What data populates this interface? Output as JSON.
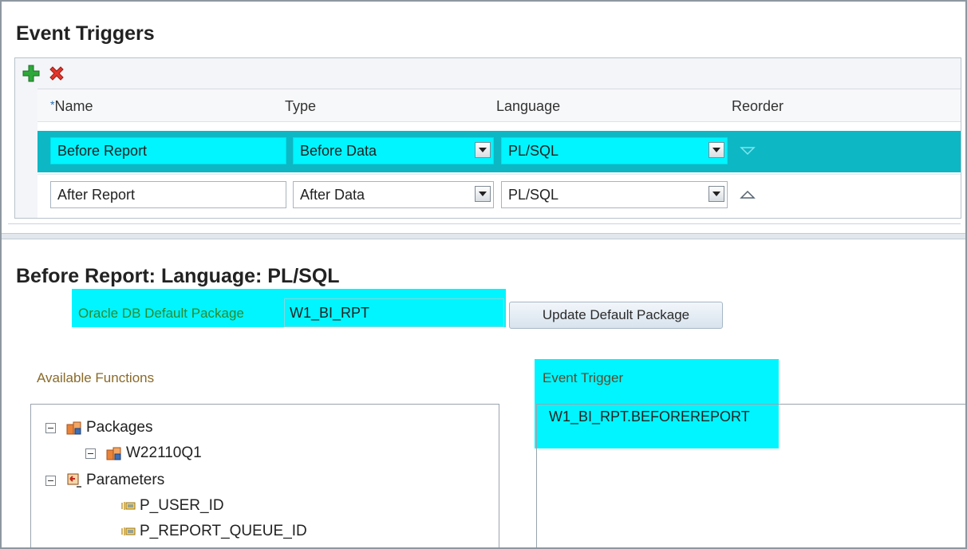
{
  "event_triggers": {
    "title": "Event Triggers",
    "toolbar": {
      "add_icon": "plus-icon",
      "delete_icon": "delete-x-icon"
    },
    "columns": {
      "name": "Name",
      "name_required_marker": "*",
      "type": "Type",
      "language": "Language",
      "reorder": "Reorder"
    },
    "rows": [
      {
        "name": "Before Report",
        "type": "Before Data",
        "language": "PL/SQL",
        "reorder_icon": "move-down-icon"
      },
      {
        "name": "After Report",
        "type": "After Data",
        "language": "PL/SQL",
        "reorder_icon": "move-up-icon"
      }
    ]
  },
  "detail": {
    "title": "Before Report: Language: PL/SQL",
    "package_label": "Oracle DB Default Package",
    "package_value": "W1_BI_RPT",
    "update_button": "Update Default Package",
    "available_functions_label": "Available Functions",
    "tree": [
      {
        "label": "Packages",
        "icon": "package-icon"
      },
      {
        "label": "W22110Q1",
        "icon": "package-icon"
      },
      {
        "label": "Parameters",
        "icon": "parameters-icon"
      },
      {
        "label": "P_USER_ID",
        "icon": "parameter-icon"
      },
      {
        "label": "P_REPORT_QUEUE_ID",
        "icon": "parameter-icon"
      }
    ],
    "event_trigger_label": "Event Trigger",
    "event_trigger_value": "W1_BI_RPT.BEFOREREPORT"
  },
  "colors": {
    "selection": "#0db7c4",
    "highlight": "#00f5ff",
    "label_green": "#2c8a2c"
  }
}
